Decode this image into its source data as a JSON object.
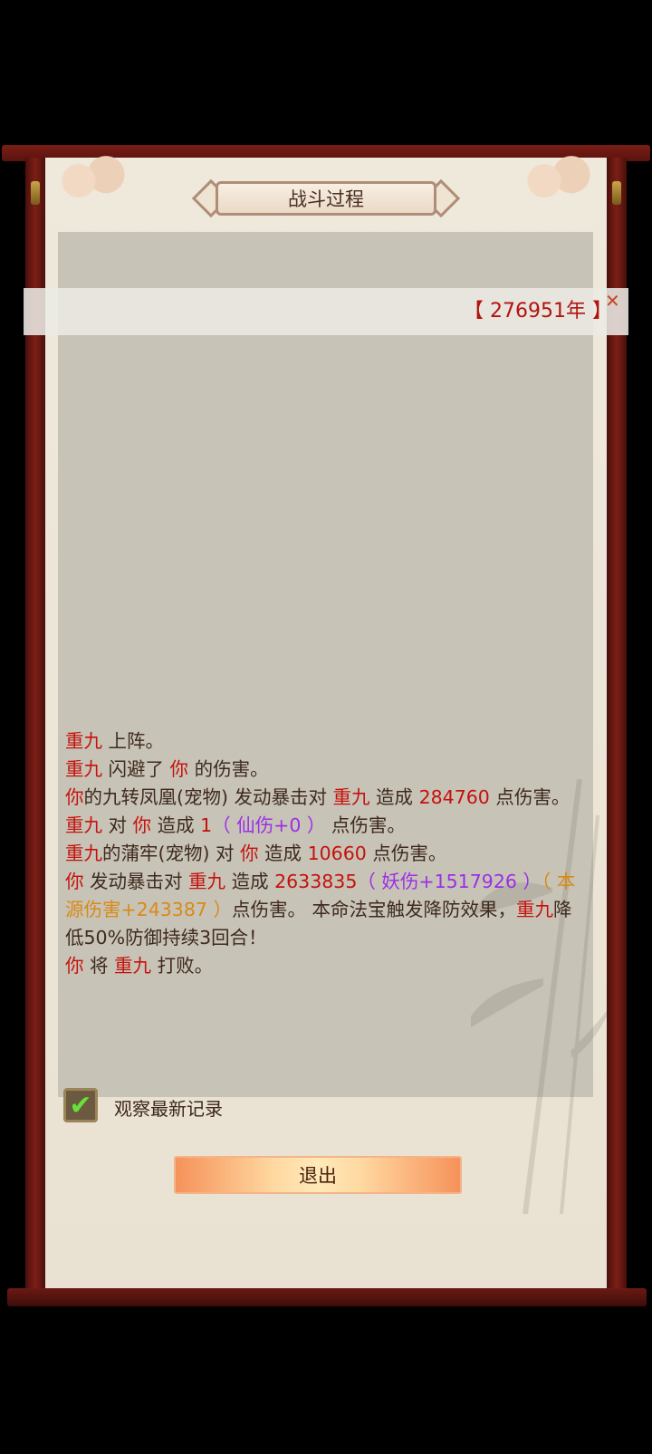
{
  "dialog": {
    "title": "战斗过程"
  },
  "notice": {
    "text": "【 276951年 】"
  },
  "log": [
    [
      {
        "t": "重九",
        "c": "r"
      },
      {
        "t": " 上阵。"
      }
    ],
    [
      {
        "t": "重九",
        "c": "r"
      },
      {
        "t": " 闪避了 "
      },
      {
        "t": "你",
        "c": "r"
      },
      {
        "t": " 的伤害。"
      }
    ],
    [
      {
        "t": "你",
        "c": "r"
      },
      {
        "t": "的九转凤凰(宠物) 发动暴击对 "
      },
      {
        "t": "重九",
        "c": "r"
      },
      {
        "t": " 造成 "
      },
      {
        "t": "284760",
        "c": "r"
      },
      {
        "t": " 点伤害。"
      }
    ],
    [
      {
        "t": "重九",
        "c": "r"
      },
      {
        "t": " 对 "
      },
      {
        "t": "你",
        "c": "r"
      },
      {
        "t": " 造成 "
      },
      {
        "t": "1",
        "c": "r"
      },
      {
        "t": "（ 仙伤+0 ）",
        "c": "p"
      },
      {
        "t": " 点伤害。"
      }
    ],
    [
      {
        "t": "重九",
        "c": "r"
      },
      {
        "t": "的蒲牢(宠物) 对 "
      },
      {
        "t": "你",
        "c": "r"
      },
      {
        "t": " 造成 "
      },
      {
        "t": "10660",
        "c": "r"
      },
      {
        "t": " 点伤害。"
      }
    ],
    [
      {
        "t": "你",
        "c": "r"
      },
      {
        "t": " 发动暴击对 "
      },
      {
        "t": "重九",
        "c": "r"
      },
      {
        "t": " 造成 "
      },
      {
        "t": "2633835",
        "c": "r"
      },
      {
        "t": "（ 妖伤+1517926 ）",
        "c": "p"
      },
      {
        "t": "（ 本源伤害+243387 ）",
        "c": "o"
      },
      {
        "t": "点伤害。 本命法宝触发降防效果，"
      },
      {
        "t": "重九",
        "c": "r"
      },
      {
        "t": "降低50%防御持续3回合！"
      }
    ],
    [
      {
        "t": "你",
        "c": "r"
      },
      {
        "t": " 将 "
      },
      {
        "t": "重九",
        "c": "r"
      },
      {
        "t": " 打败。"
      }
    ]
  ],
  "options": {
    "watch_latest_label": "观察最新记录",
    "watch_latest_checked": true
  },
  "buttons": {
    "exit_label": "退出"
  },
  "icons": {
    "close": "close-icon",
    "check": "checkmark-icon"
  },
  "colors": {
    "highlight_red": "#c4120c",
    "purple": "#9b2fe6",
    "orange": "#d88a17"
  }
}
